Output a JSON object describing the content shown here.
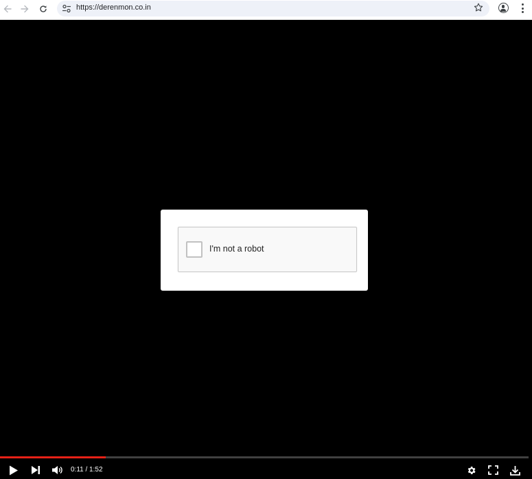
{
  "browser": {
    "url": "https://derenmon.co.in",
    "back_icon": "arrow-left-icon",
    "forward_icon": "arrow-right-icon",
    "reload_icon": "reload-icon",
    "site_info_icon": "tune-icon",
    "bookmark_icon": "star-icon",
    "profile_icon": "account-circle-icon",
    "menu_icon": "three-dots-vertical-icon"
  },
  "captcha": {
    "label": "I'm not a robot",
    "checked": false
  },
  "player": {
    "time_display": "0:11 / 1:52",
    "progress_fraction": 0.2,
    "accent_color": "#e62117",
    "controls": [
      "play-icon",
      "next-icon",
      "volume-icon",
      "settings-icon",
      "fullscreen-icon",
      "download-icon"
    ]
  }
}
